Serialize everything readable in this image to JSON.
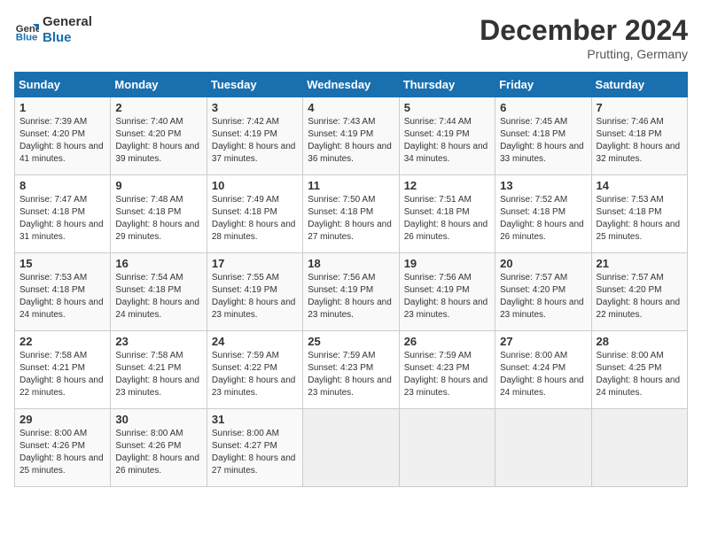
{
  "logo": {
    "line1": "General",
    "line2": "Blue"
  },
  "title": "December 2024",
  "subtitle": "Prutting, Germany",
  "days_of_week": [
    "Sunday",
    "Monday",
    "Tuesday",
    "Wednesday",
    "Thursday",
    "Friday",
    "Saturday"
  ],
  "weeks": [
    [
      {
        "day": "1",
        "sunrise": "7:39 AM",
        "sunset": "4:20 PM",
        "daylight": "8 hours and 41 minutes."
      },
      {
        "day": "2",
        "sunrise": "7:40 AM",
        "sunset": "4:20 PM",
        "daylight": "8 hours and 39 minutes."
      },
      {
        "day": "3",
        "sunrise": "7:42 AM",
        "sunset": "4:19 PM",
        "daylight": "8 hours and 37 minutes."
      },
      {
        "day": "4",
        "sunrise": "7:43 AM",
        "sunset": "4:19 PM",
        "daylight": "8 hours and 36 minutes."
      },
      {
        "day": "5",
        "sunrise": "7:44 AM",
        "sunset": "4:19 PM",
        "daylight": "8 hours and 34 minutes."
      },
      {
        "day": "6",
        "sunrise": "7:45 AM",
        "sunset": "4:18 PM",
        "daylight": "8 hours and 33 minutes."
      },
      {
        "day": "7",
        "sunrise": "7:46 AM",
        "sunset": "4:18 PM",
        "daylight": "8 hours and 32 minutes."
      }
    ],
    [
      {
        "day": "8",
        "sunrise": "7:47 AM",
        "sunset": "4:18 PM",
        "daylight": "8 hours and 31 minutes."
      },
      {
        "day": "9",
        "sunrise": "7:48 AM",
        "sunset": "4:18 PM",
        "daylight": "8 hours and 29 minutes."
      },
      {
        "day": "10",
        "sunrise": "7:49 AM",
        "sunset": "4:18 PM",
        "daylight": "8 hours and 28 minutes."
      },
      {
        "day": "11",
        "sunrise": "7:50 AM",
        "sunset": "4:18 PM",
        "daylight": "8 hours and 27 minutes."
      },
      {
        "day": "12",
        "sunrise": "7:51 AM",
        "sunset": "4:18 PM",
        "daylight": "8 hours and 26 minutes."
      },
      {
        "day": "13",
        "sunrise": "7:52 AM",
        "sunset": "4:18 PM",
        "daylight": "8 hours and 26 minutes."
      },
      {
        "day": "14",
        "sunrise": "7:53 AM",
        "sunset": "4:18 PM",
        "daylight": "8 hours and 25 minutes."
      }
    ],
    [
      {
        "day": "15",
        "sunrise": "7:53 AM",
        "sunset": "4:18 PM",
        "daylight": "8 hours and 24 minutes."
      },
      {
        "day": "16",
        "sunrise": "7:54 AM",
        "sunset": "4:18 PM",
        "daylight": "8 hours and 24 minutes."
      },
      {
        "day": "17",
        "sunrise": "7:55 AM",
        "sunset": "4:19 PM",
        "daylight": "8 hours and 23 minutes."
      },
      {
        "day": "18",
        "sunrise": "7:56 AM",
        "sunset": "4:19 PM",
        "daylight": "8 hours and 23 minutes."
      },
      {
        "day": "19",
        "sunrise": "7:56 AM",
        "sunset": "4:19 PM",
        "daylight": "8 hours and 23 minutes."
      },
      {
        "day": "20",
        "sunrise": "7:57 AM",
        "sunset": "4:20 PM",
        "daylight": "8 hours and 23 minutes."
      },
      {
        "day": "21",
        "sunrise": "7:57 AM",
        "sunset": "4:20 PM",
        "daylight": "8 hours and 22 minutes."
      }
    ],
    [
      {
        "day": "22",
        "sunrise": "7:58 AM",
        "sunset": "4:21 PM",
        "daylight": "8 hours and 22 minutes."
      },
      {
        "day": "23",
        "sunrise": "7:58 AM",
        "sunset": "4:21 PM",
        "daylight": "8 hours and 23 minutes."
      },
      {
        "day": "24",
        "sunrise": "7:59 AM",
        "sunset": "4:22 PM",
        "daylight": "8 hours and 23 minutes."
      },
      {
        "day": "25",
        "sunrise": "7:59 AM",
        "sunset": "4:23 PM",
        "daylight": "8 hours and 23 minutes."
      },
      {
        "day": "26",
        "sunrise": "7:59 AM",
        "sunset": "4:23 PM",
        "daylight": "8 hours and 23 minutes."
      },
      {
        "day": "27",
        "sunrise": "8:00 AM",
        "sunset": "4:24 PM",
        "daylight": "8 hours and 24 minutes."
      },
      {
        "day": "28",
        "sunrise": "8:00 AM",
        "sunset": "4:25 PM",
        "daylight": "8 hours and 24 minutes."
      }
    ],
    [
      {
        "day": "29",
        "sunrise": "8:00 AM",
        "sunset": "4:26 PM",
        "daylight": "8 hours and 25 minutes."
      },
      {
        "day": "30",
        "sunrise": "8:00 AM",
        "sunset": "4:26 PM",
        "daylight": "8 hours and 26 minutes."
      },
      {
        "day": "31",
        "sunrise": "8:00 AM",
        "sunset": "4:27 PM",
        "daylight": "8 hours and 27 minutes."
      },
      null,
      null,
      null,
      null
    ]
  ]
}
